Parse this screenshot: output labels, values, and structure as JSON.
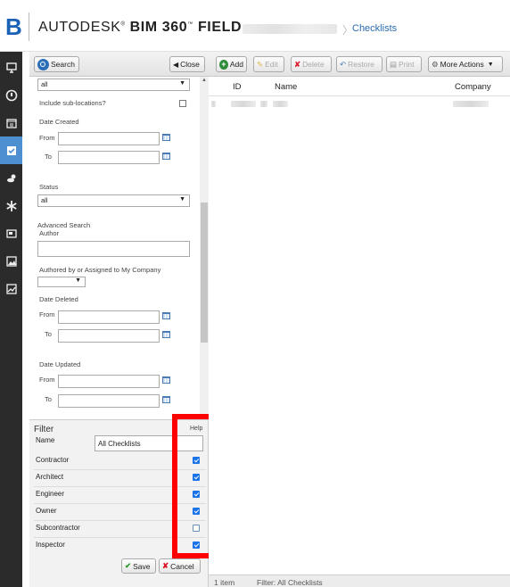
{
  "header": {
    "logo_letter": "B",
    "brand_prefix": "AUTODESK",
    "brand_product": "BIM 360",
    "brand_suffix": "FIELD",
    "breadcrumb_link": "Checklists"
  },
  "rail": {
    "items": [
      {
        "icon": "monitor-icon"
      },
      {
        "icon": "info-circle-icon"
      },
      {
        "icon": "calendar-icon"
      },
      {
        "icon": "checklist-icon",
        "active": true
      },
      {
        "icon": "weather-icon"
      },
      {
        "icon": "asterisk-icon"
      },
      {
        "icon": "equipment-icon"
      },
      {
        "icon": "image-icon"
      },
      {
        "icon": "chart-icon"
      }
    ]
  },
  "search_panel": {
    "search_label": "Search",
    "close_label": "Close",
    "top_select_value": "all",
    "include_sublocations": "Include sub-locations?",
    "date_created": "Date Created",
    "from": "From",
    "to": "To",
    "status_label": "Status",
    "status_value": "all",
    "advanced_search": "Advanced Search",
    "author": "Author",
    "authored_by": "Authored by or Assigned to My Company",
    "date_deleted": "Date Deleted",
    "date_updated": "Date Updated"
  },
  "filter": {
    "title": "Filter",
    "help": "Help",
    "name_label": "Name",
    "name_value": "All Checklists",
    "rows": [
      {
        "label": "Contractor",
        "checked": true
      },
      {
        "label": "Architect",
        "checked": true
      },
      {
        "label": "Engineer",
        "checked": true
      },
      {
        "label": "Owner",
        "checked": true
      },
      {
        "label": "Subcontractor",
        "checked": false
      },
      {
        "label": "Inspector",
        "checked": true
      }
    ],
    "save_label": "Save",
    "cancel_label": "Cancel"
  },
  "main": {
    "toolbar": {
      "add": "Add",
      "edit": "Edit",
      "delete": "Delete",
      "restore": "Restore",
      "print": "Print",
      "more_actions": "More Actions"
    },
    "columns": [
      "ID",
      "Name",
      "Company"
    ],
    "status_count": "1 item",
    "status_filter": "Filter: All Checklists"
  },
  "colors": {
    "brand_blue": "#1b62b7",
    "rail_bg": "#2b2b2b",
    "rail_active": "#4e8fd1",
    "highlight": "#ff0000"
  }
}
